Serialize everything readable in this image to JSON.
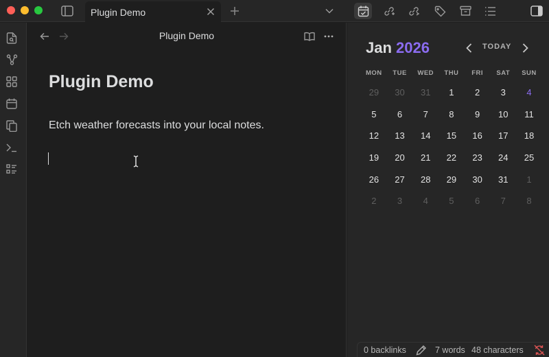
{
  "window": {
    "tab_title": "Plugin Demo"
  },
  "editor": {
    "view_title": "Plugin Demo",
    "doc_title": "Plugin Demo",
    "doc_text": "Etch weather forecasts into your local notes."
  },
  "calendar": {
    "month": "Jan",
    "year": "2026",
    "today_label": "TODAY",
    "weekdays": [
      "MON",
      "TUE",
      "WED",
      "THU",
      "FRI",
      "SAT",
      "SUN"
    ],
    "weeks": [
      [
        "29",
        "30",
        "31",
        "1",
        "2",
        "3",
        "4"
      ],
      [
        "5",
        "6",
        "7",
        "8",
        "9",
        "10",
        "11"
      ],
      [
        "12",
        "13",
        "14",
        "15",
        "16",
        "17",
        "18"
      ],
      [
        "19",
        "20",
        "21",
        "22",
        "23",
        "24",
        "25"
      ],
      [
        "26",
        "27",
        "28",
        "29",
        "30",
        "31",
        "1"
      ],
      [
        "2",
        "3",
        "4",
        "5",
        "6",
        "7",
        "8"
      ]
    ],
    "accent_color": "#8b6cf0"
  },
  "status": {
    "backlinks": "0 backlinks",
    "words": "7 words",
    "characters": "48 characters"
  },
  "icons": {
    "ribbon": [
      "file-search-icon",
      "graph-icon",
      "canvas-icon",
      "calendar-icon",
      "copy-icon",
      "terminal-icon",
      "list-checks-icon"
    ],
    "titlebar_right": [
      "calendar-check-icon",
      "link-icon",
      "outgoing-link-icon",
      "tag-icon",
      "archive-icon",
      "outline-icon",
      "sidebar-right-icon"
    ]
  }
}
